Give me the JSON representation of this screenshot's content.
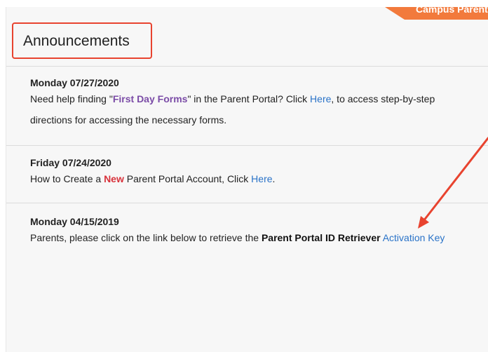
{
  "header": {
    "brand_text": "Campus Parent",
    "title": "Announcements"
  },
  "announcements": [
    {
      "date": "Monday 07/27/2020",
      "t1": "Need help finding \"",
      "t2": "First Day Forms",
      "t3": "\" in the Parent Portal? Click ",
      "link": "Here",
      "t4": ", to access step-by-step directions for accessing the necessary forms."
    },
    {
      "date": "Friday 07/24/2020",
      "t1": "How to Create a ",
      "t2": "New",
      "t3": " Parent Portal Account, Click ",
      "link": "Here",
      "t4": "."
    },
    {
      "date": "Monday 04/15/2019",
      "t1": "Parents, please click on the link below to retrieve the ",
      "t2": "Parent Portal ID Retriever",
      "t3": " ",
      "link": "Activation Key",
      "t4": ""
    }
  ],
  "colors": {
    "accent_orange": "#f27a3c",
    "highlight_red": "#e8432f",
    "link_blue": "#2a73c8",
    "purple": "#7b4ca7"
  }
}
